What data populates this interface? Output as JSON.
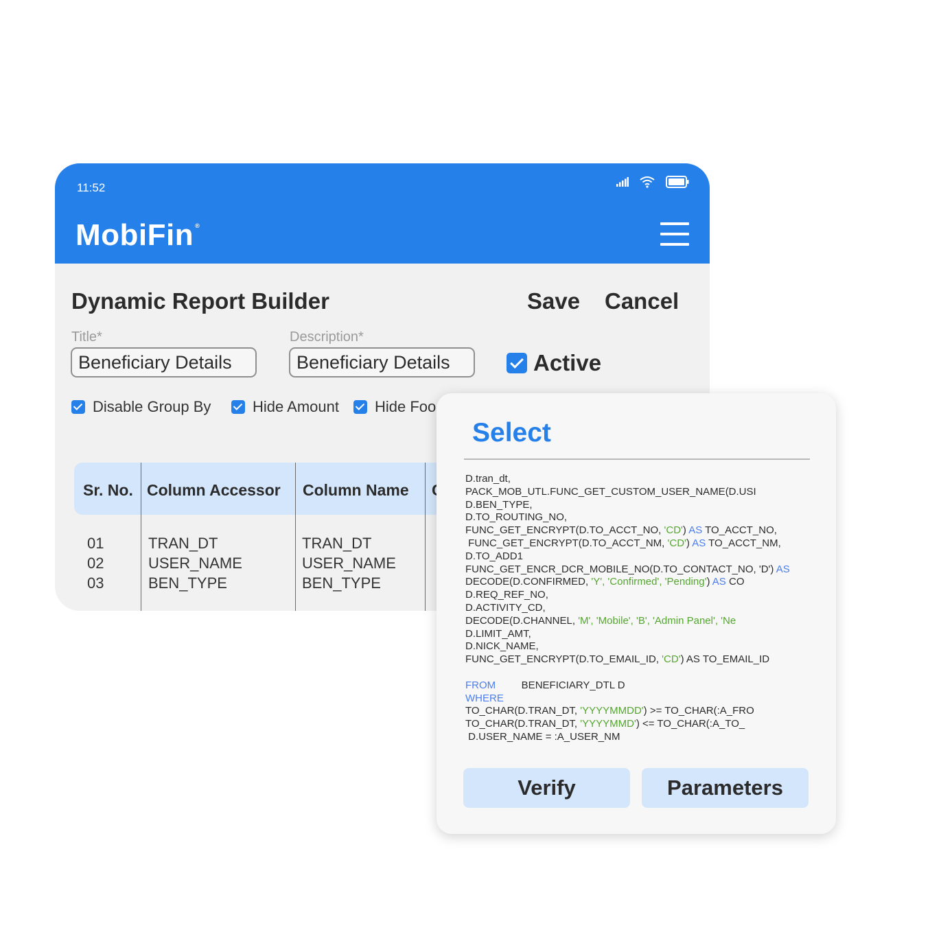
{
  "status_bar": {
    "time": "11:52",
    "icons": [
      "signal-icon",
      "wifi-icon",
      "battery-icon"
    ]
  },
  "app": {
    "logo": "MobiFin",
    "logo_mark": "®",
    "menu_icon": "hamburger-menu-icon"
  },
  "page": {
    "title": "Dynamic Report Builder",
    "save_label": "Save",
    "cancel_label": "Cancel"
  },
  "form": {
    "title_label": "Title*",
    "title_value": "Beneficiary Details",
    "description_label": "Description*",
    "description_value": "Beneficiary Details",
    "active_label": "Active",
    "active_checked": true
  },
  "options": [
    {
      "label": "Disable Group By",
      "checked": true
    },
    {
      "label": "Hide Amount",
      "checked": true
    },
    {
      "label": "Hide Foo",
      "checked": true
    }
  ],
  "table": {
    "headers": [
      "Sr. No.",
      "Column Accessor",
      "Column Name",
      "C"
    ],
    "rows": [
      {
        "sr": "01",
        "accessor": "TRAN_DT",
        "name": "TRAN_DT"
      },
      {
        "sr": "02",
        "accessor": "USER_NAME",
        "name": "USER_NAME"
      },
      {
        "sr": "03",
        "accessor": "BEN_TYPE",
        "name": "BEN_TYPE"
      }
    ]
  },
  "select_panel": {
    "title": "Select",
    "sql_lines": [
      [
        {
          "t": "D.tran_dt,"
        }
      ],
      [
        {
          "t": "PACK_MOB_UTL.FUNC_GET_CUSTOM_USER_NAME(D.USI"
        }
      ],
      [
        {
          "t": "D.BEN_TYPE,"
        }
      ],
      [
        {
          "t": "D.TO_ROUTING_NO,"
        }
      ],
      [
        {
          "t": "FUNC_GET_ENCRYPT(D.TO_ACCT_NO, "
        },
        {
          "t": "'CD'",
          "c": "str"
        },
        {
          "t": ") "
        },
        {
          "t": "AS",
          "c": "kw"
        },
        {
          "t": " TO_ACCT_NO,"
        }
      ],
      [
        {
          "t": " FUNC_GET_ENCRYPT(D.TO_ACCT_NM, "
        },
        {
          "t": "'CD'",
          "c": "str"
        },
        {
          "t": ") "
        },
        {
          "t": "AS",
          "c": "kw"
        },
        {
          "t": " TO_ACCT_NM,"
        }
      ],
      [
        {
          "t": "D.TO_ADD1"
        }
      ],
      [
        {
          "t": "FUNC_GET_ENCR_DCR_MOBILE_NO(D.TO_CONTACT_NO, 'D') "
        },
        {
          "t": "AS",
          "c": "kw"
        }
      ],
      [
        {
          "t": "DECODE(D.CONFIRMED, "
        },
        {
          "t": "'Y', 'Confirmed', 'Pending'",
          "c": "str"
        },
        {
          "t": ") "
        },
        {
          "t": "AS",
          "c": "kw"
        },
        {
          "t": " CO"
        }
      ],
      [
        {
          "t": "D.REQ_REF_NO,"
        }
      ],
      [
        {
          "t": "D.ACTIVITY_CD,"
        }
      ],
      [
        {
          "t": "DECODE(D.CHANNEL, "
        },
        {
          "t": "'M', 'Mobile', 'B', 'Admin Panel', 'Ne",
          "c": "str"
        }
      ],
      [
        {
          "t": "D.LIMIT_AMT,"
        }
      ],
      [
        {
          "t": "D.NICK_NAME,"
        }
      ],
      [
        {
          "t": "FUNC_GET_ENCRYPT(D.TO_EMAIL_ID, "
        },
        {
          "t": "'CD'",
          "c": "str"
        },
        {
          "t": ") AS TO_EMAIL_ID"
        }
      ],
      [
        {
          "t": ""
        }
      ],
      [
        {
          "t": "FROM",
          "c": "kw"
        },
        {
          "t": "         BENEFICIARY_DTL D"
        }
      ],
      [
        {
          "t": "WHERE",
          "c": "kw"
        }
      ],
      [
        {
          "t": "TO_CHAR(D.TRAN_DT, "
        },
        {
          "t": "'YYYYMMDD'",
          "c": "str"
        },
        {
          "t": ") >= TO_CHAR(:A_FRO"
        }
      ],
      [
        {
          "t": "TO_CHAR(D.TRAN_DT, "
        },
        {
          "t": "'YYYYMMD'",
          "c": "str"
        },
        {
          "t": ") <= TO_CHAR(:A_TO_"
        }
      ],
      [
        {
          "t": " D.USER_NAME = :A_USER_NM"
        }
      ]
    ],
    "verify_label": "Verify",
    "parameters_label": "Parameters"
  },
  "colors": {
    "brand_blue": "#2680ea",
    "header_blue": "#d4e6fb",
    "keyword_blue": "#4a7ef0",
    "string_green": "#55a630"
  }
}
